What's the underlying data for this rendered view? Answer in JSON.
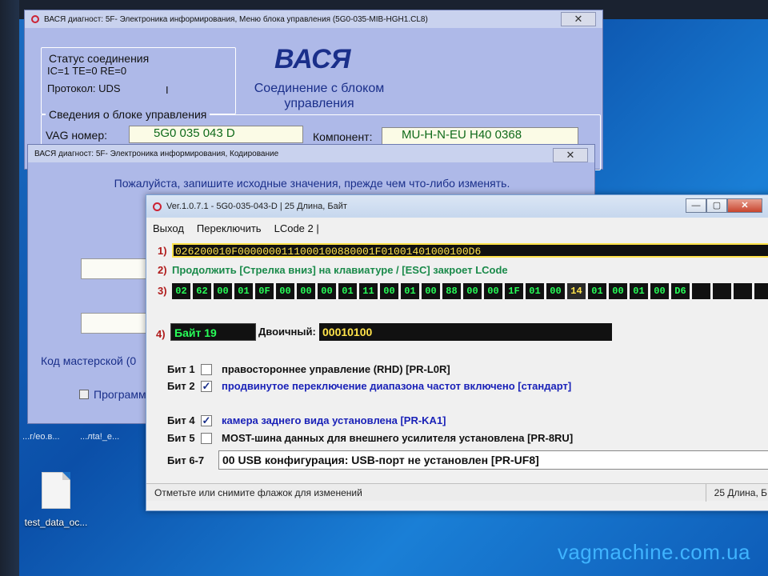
{
  "window_back": {
    "title": "ВАСЯ диагност: 5F- Электроника информирования,  Меню блока управления (5G0-035-MIB-HGH1.CL8)",
    "close": "✕",
    "status_group_title": "Статус соединения",
    "ic_line": "IC=1  TE=0  RE=0",
    "protocol": "Протокол: UDS",
    "cursor_mark": "I",
    "brand": "ВАСЯ",
    "connection_title": "Соединение с блоком управления",
    "info_group_title": "Сведения о блоке управления",
    "vag_label": "VAG номер:",
    "vag_value": "5G0 035 043 D",
    "component_label": "Компонент:",
    "component_value": "MU-H-N-EU     H40 0368"
  },
  "window_mid": {
    "title": "ВАСЯ диагност: 5F- Электроника информирования,  Кодирование",
    "close": "✕",
    "note": "Пожалуйста, запишите исходные значения, прежде чем что-либо изменять.",
    "workshop_code_label": "Код мастерской (0",
    "program_label": "Программ"
  },
  "window_front": {
    "title": "Ver.1.0.7.1 -   5G0-035-043-D | 25 Длина, Байт",
    "menu": [
      "Выход",
      "Переключить",
      "LCode 2 |"
    ],
    "row1_num": "1)",
    "hex_string": "026200010F0000000111000100880001F01001401000100D6",
    "row2_num": "2)",
    "hint": "Продолжить [Стрелка вниз] на клавиатуре / [ESC] закроет LCode",
    "row3_num": "3)",
    "bytes": [
      "02",
      "62",
      "00",
      "01",
      "0F",
      "00",
      "00",
      "00",
      "01",
      "11",
      "00",
      "01",
      "00",
      "88",
      "00",
      "00",
      "1F",
      "01",
      "00",
      "14",
      "01",
      "00",
      "01",
      "00",
      "D6",
      "",
      "",
      "",
      "",
      ""
    ],
    "selected_byte_index": 19,
    "row4_num": "4)",
    "byte_label": "Байт 19",
    "binary_label": "Двоичный:",
    "binary_value": "00010100",
    "bits": [
      {
        "name": "Бит 1",
        "checked": false,
        "text": "правостороннее управление (RHD) [PR-L0R]",
        "color": "#111111"
      },
      {
        "name": "Бит 2",
        "checked": true,
        "text": "продвинутое переключение диапазона частот включено [стандарт]",
        "color": "#1a22b8"
      },
      {
        "name": "Бит 4",
        "checked": true,
        "text": "камера заднего вида установлена [PR-KA1]",
        "color": "#1a22b8"
      },
      {
        "name": "Бит 5",
        "checked": false,
        "text": "MOST-шина данных для внешнего усилителя установлена [PR-8RU]",
        "color": "#111111"
      }
    ],
    "bits67_label": "Бит 6-7",
    "bits67_value": "00 USB конфигурация: USB-порт не установлен [PR-UF8]",
    "status_left": "Отметьте или снимите флажок для изменений",
    "status_right": "25 Длина, Б"
  },
  "desktop": {
    "icon_label": "test_data_oc...",
    "top_labels": [
      "...г/ео.в...",
      "...лtа!_е..."
    ],
    "watermark": "vagmachine.com.ua"
  }
}
